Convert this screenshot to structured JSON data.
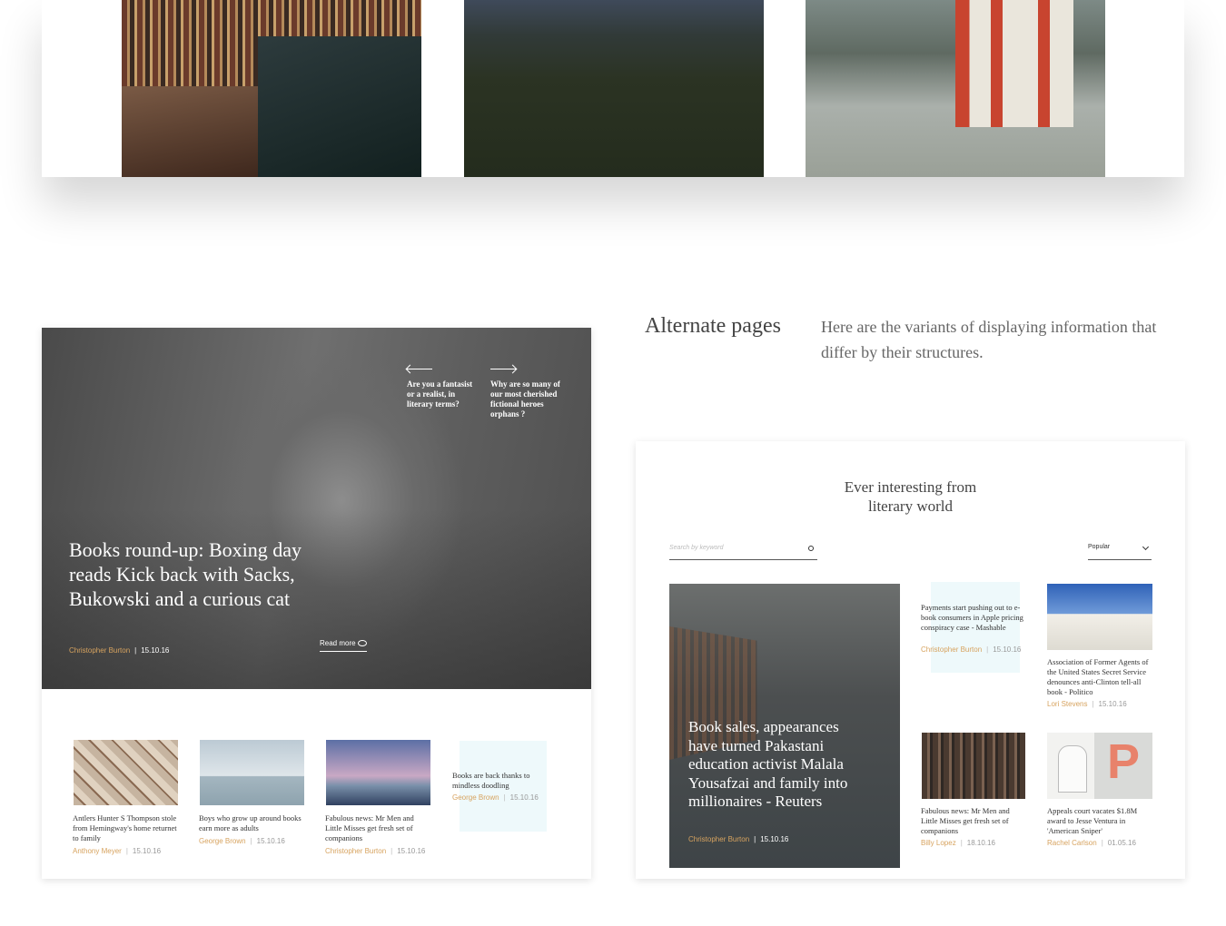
{
  "section": {
    "title": "Alternate pages",
    "description": "Here are the variants of displaying information that differ by their structures."
  },
  "left_page": {
    "nav": [
      {
        "text": "Are you a fantasist or a realist, in literary terms?"
      },
      {
        "text": "Why are so many of our most cherished fictional heroes orphans ?"
      }
    ],
    "hero": {
      "title": "Books round-up: Boxing day reads Kick back with Sacks, Bukowski and a curious cat",
      "author": "Christopher Burton",
      "date": "15.10.16",
      "read_more": "Read more"
    },
    "articles": [
      {
        "title": "Antlers Hunter S Thompson stole from Hemingway's home returnet to family",
        "author": "Anthony Meyer",
        "date": "15.10.16"
      },
      {
        "title": "Boys who grow up around books earn more as adults",
        "author": "George Brown",
        "date": "15.10.16"
      },
      {
        "title": "Fabulous news: Mr Men and Little Misses get fresh set of companions",
        "author": "Christopher Burton",
        "date": "15.10.16"
      },
      {
        "title": "Books are back thanks to mindless doodling",
        "author": "George Brown",
        "date": "15.10.16"
      }
    ]
  },
  "right_page": {
    "title": "Ever interesting from literary world",
    "search_placeholder": "Search by keyword",
    "sort_selected": "Popular",
    "feature": {
      "title": "Book sales, appearances have turned Pakastani education activist Malala Yousafzai and family into millionaires - Reuters",
      "author": "Christopher Burton",
      "date": "15.10.16"
    },
    "articles": [
      {
        "title": "Payments start pushing out to e-book consumers in Apple pricing conspiracy case - Mashable",
        "author": "Christopher Burton",
        "date": "15.10.16"
      },
      {
        "title": "Association of Former Agents of the United States Secret Service denounces anti-Clinton tell-all book - Politico",
        "author": "Lori Stevens",
        "date": "15.10.16"
      },
      {
        "title": "Fabulous news: Mr Men and Little Misses get fresh set of companions",
        "author": "Billy Lopez",
        "date": "18.10.16"
      },
      {
        "title": "Appeals court vacates $1.8M award to Jesse Ventura in 'American Sniper'",
        "author": "Rachel Carlson",
        "date": "01.05.16"
      }
    ]
  }
}
